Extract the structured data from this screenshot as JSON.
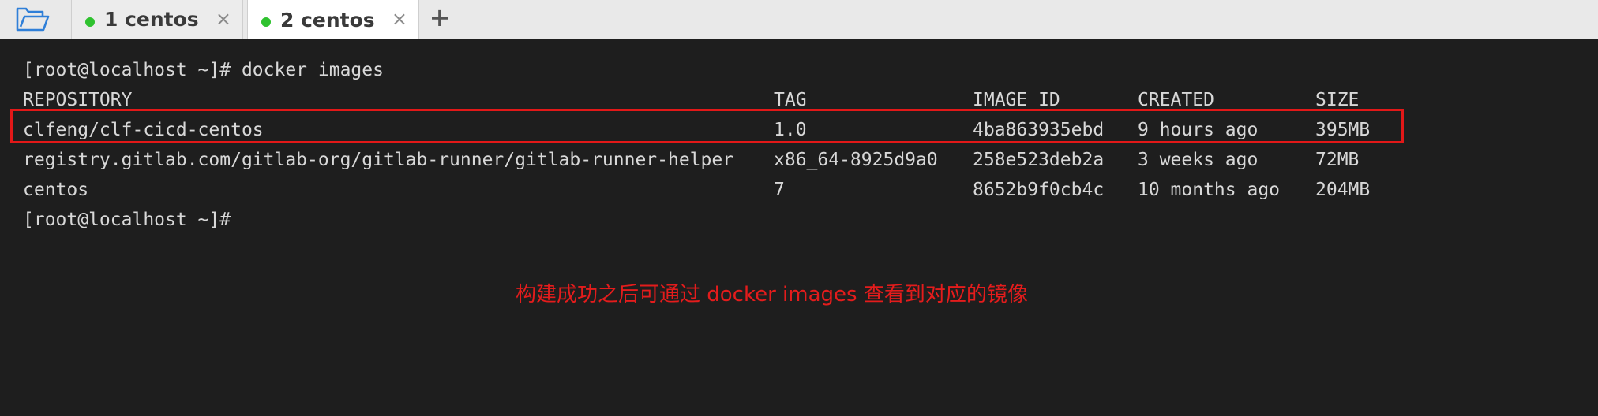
{
  "tabs": [
    {
      "label": "1 centos",
      "active": false,
      "status_color": "#2fc22f"
    },
    {
      "label": "2 centos",
      "active": true,
      "status_color": "#2fc22f"
    }
  ],
  "tab_close_glyph": "×",
  "add_tab_glyph": "+",
  "icons": {
    "open": "folder-open-icon",
    "close": "close-icon",
    "add": "plus-icon"
  },
  "terminal": {
    "command_line": "[root@localhost ~]# docker images",
    "headers": [
      "REPOSITORY",
      "TAG",
      "IMAGE ID",
      "CREATED",
      "SIZE"
    ],
    "rows": [
      [
        "clfeng/clf-cicd-centos",
        "1.0",
        "4ba863935ebd",
        "9 hours ago",
        "395MB"
      ],
      [
        "registry.gitlab.com/gitlab-org/gitlab-runner/gitlab-runner-helper",
        "x86_64-8925d9a0",
        "258e523deb2a",
        "3 weeks ago",
        "72MB"
      ],
      [
        "centos",
        "7",
        "8652b9f0cb4c",
        "10 months ago",
        "204MB"
      ]
    ],
    "prompt": "[root@localhost ~]#"
  },
  "annotation": {
    "text": "构建成功之后可通过 docker images 查看到对应的镜像",
    "color": "#e41c1c",
    "highlighted_row": 0
  }
}
